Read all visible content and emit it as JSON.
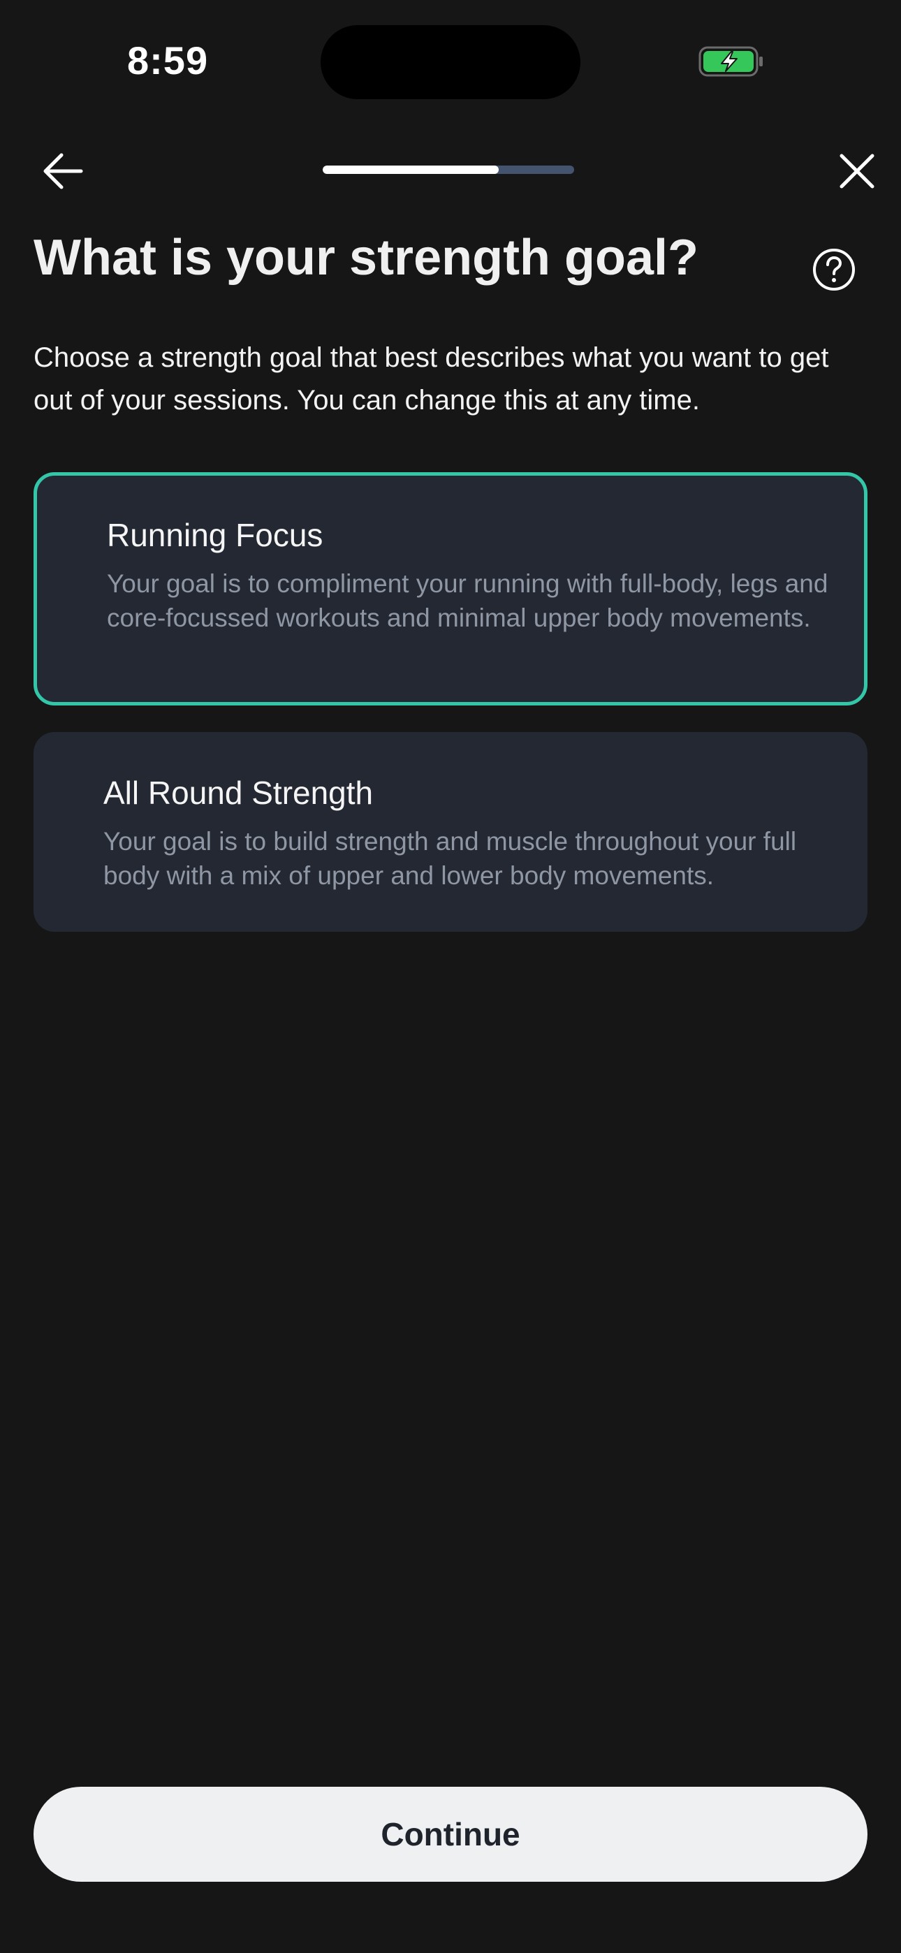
{
  "status_bar": {
    "time": "8:59",
    "battery_icon": "battery-charging-icon"
  },
  "nav": {
    "back_icon": "arrow-left-icon",
    "close_icon": "close-icon",
    "progress": 0.7
  },
  "header": {
    "title": "What is your strength goal?",
    "help_icon": "question-circle-icon",
    "description": "Choose a strength goal that best describes what you want to get out of your sessions. You can change this at any time."
  },
  "options": [
    {
      "title": "Running Focus",
      "description": "Your goal is to compliment your running with full-body, legs and core-focussed workouts and minimal upper body movements.",
      "selected": true
    },
    {
      "title": "All Round Strength",
      "description": "Your goal is to build strength and muscle throughout your full body with a mix of upper and lower body movements.",
      "selected": false
    }
  ],
  "footer": {
    "continue_label": "Continue"
  },
  "colors": {
    "background": "#161616",
    "card": "#232832",
    "accent": "#34c6a8",
    "battery_green": "#35c759",
    "progress_track": "#44546f"
  }
}
